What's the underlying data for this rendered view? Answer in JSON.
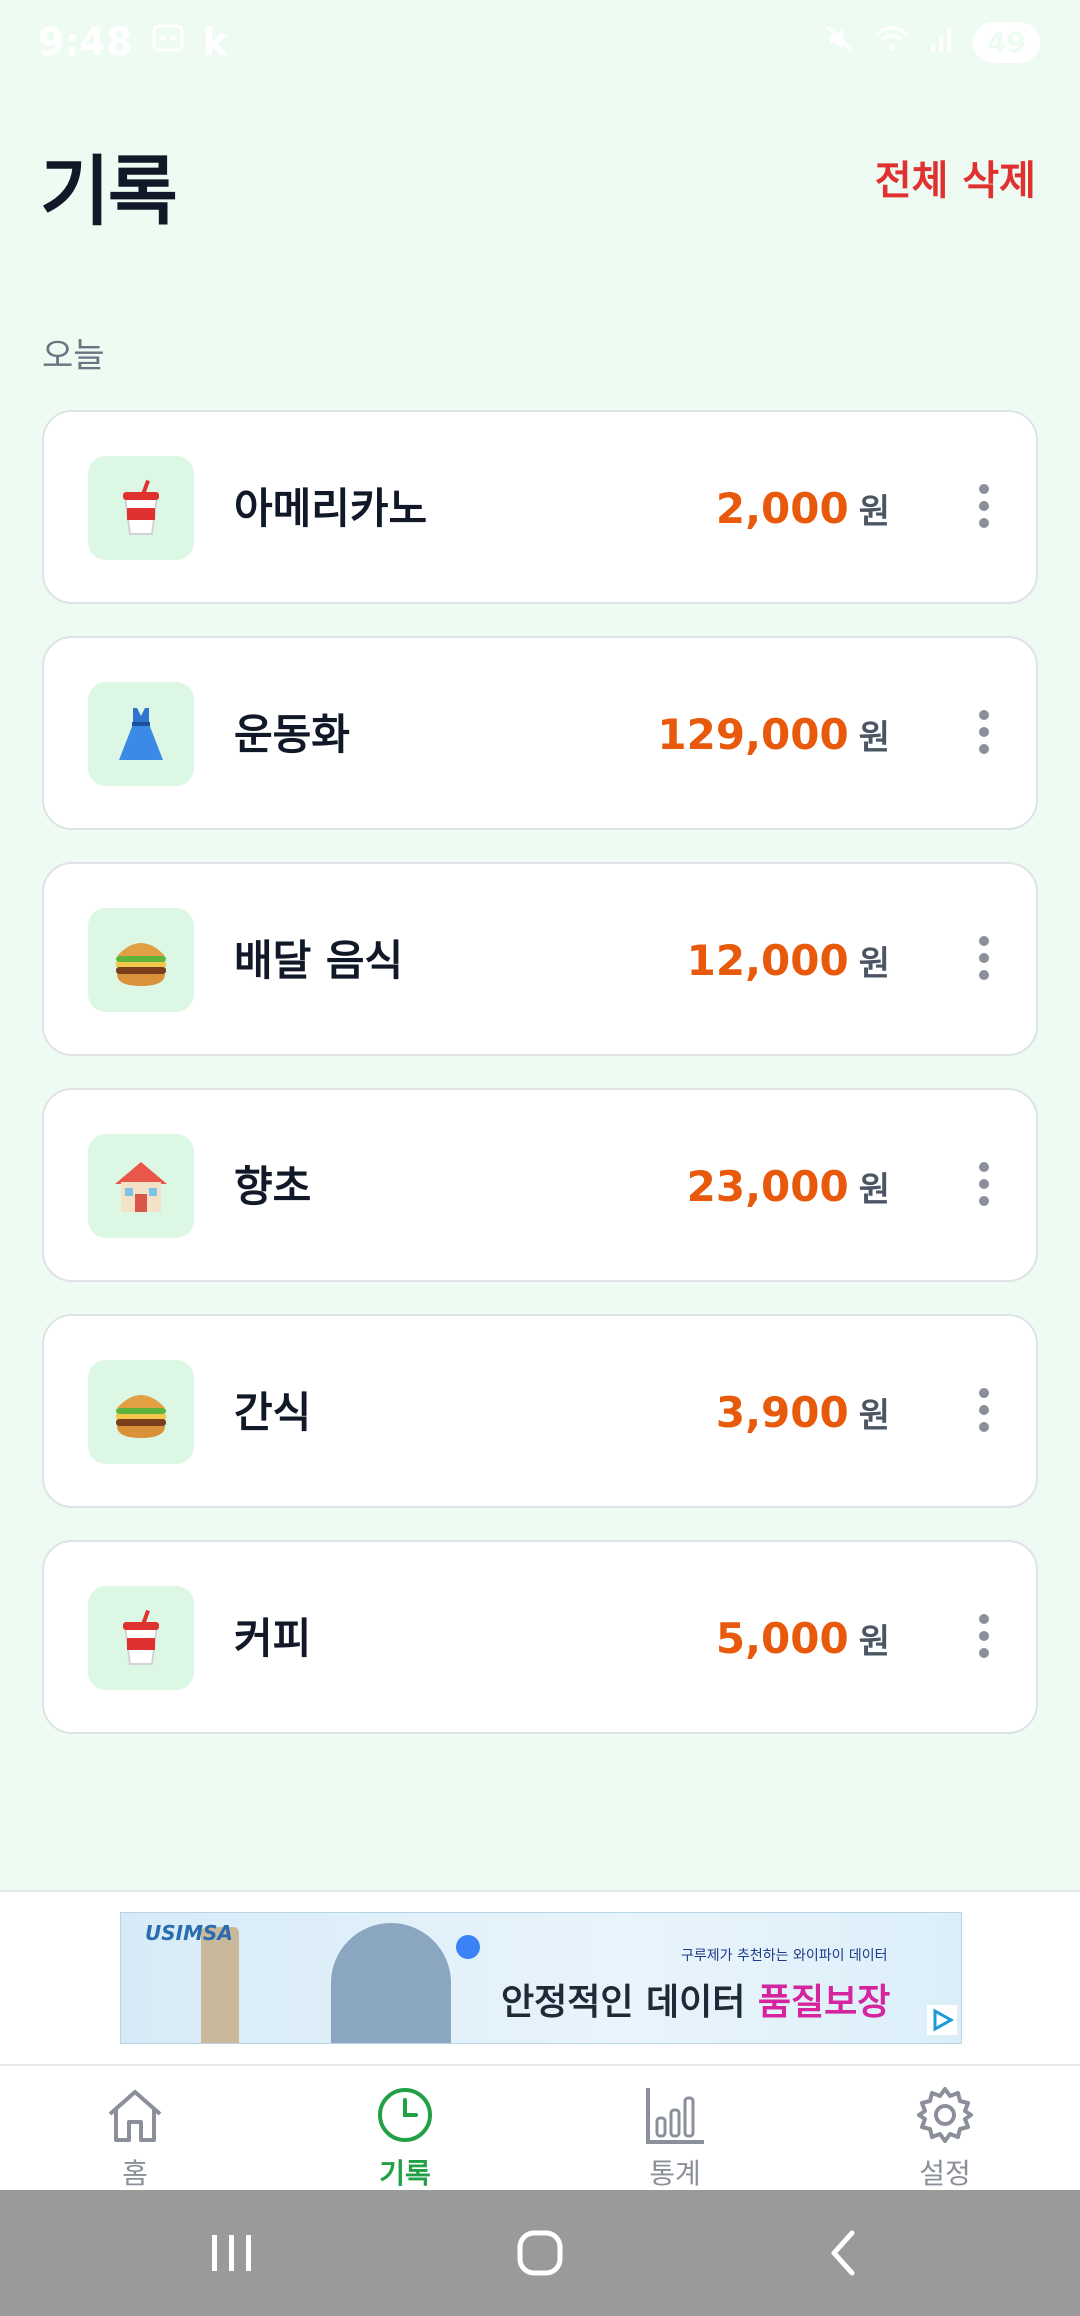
{
  "status_bar": {
    "time": "9:48",
    "extra": "k",
    "battery": "49"
  },
  "header": {
    "title": "기록",
    "delete_all_label": "전체 삭제"
  },
  "section": {
    "label": "오늘"
  },
  "records": [
    {
      "name": "아메리카노",
      "amount": "2,000",
      "currency": "원",
      "icon": "drink-cup-icon"
    },
    {
      "name": "운동화",
      "amount": "129,000",
      "currency": "원",
      "icon": "dress-icon"
    },
    {
      "name": "배달 음식",
      "amount": "12,000",
      "currency": "원",
      "icon": "burger-icon"
    },
    {
      "name": "향초",
      "amount": "23,000",
      "currency": "원",
      "icon": "house-icon"
    },
    {
      "name": "간식",
      "amount": "3,900",
      "currency": "원",
      "icon": "burger-icon"
    },
    {
      "name": "커피",
      "amount": "5,000",
      "currency": "원",
      "icon": "drink-cup-icon"
    }
  ],
  "ad": {
    "brand": "USIMSA",
    "subtext": "구루제가 추천하는 와이파이 데이터",
    "headline_prefix": "안정적인 데이터 ",
    "headline_highlight": "품질보장"
  },
  "bottom_nav": {
    "items": [
      {
        "label": "홈",
        "icon": "home-icon",
        "active": false
      },
      {
        "label": "기록",
        "icon": "clock-icon",
        "active": true
      },
      {
        "label": "통계",
        "icon": "bar-chart-icon",
        "active": false
      },
      {
        "label": "설정",
        "icon": "gear-icon",
        "active": false
      }
    ]
  },
  "colors": {
    "background": "#eefbf2",
    "accent": "#21a045",
    "amount": "#e8590c",
    "danger": "#e03131"
  }
}
